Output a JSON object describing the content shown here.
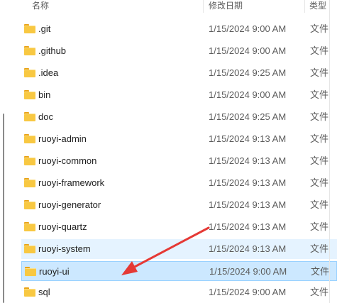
{
  "columns": {
    "name": "名称",
    "modified": "修改日期",
    "type": "类型"
  },
  "files": [
    {
      "name": ".git",
      "date": "1/15/2024 9:00 AM",
      "type": "文件",
      "icon": "folder-icon",
      "state": "normal"
    },
    {
      "name": ".github",
      "date": "1/15/2024 9:00 AM",
      "type": "文件",
      "icon": "folder-icon",
      "state": "normal"
    },
    {
      "name": ".idea",
      "date": "1/15/2024 9:25 AM",
      "type": "文件",
      "icon": "folder-icon",
      "state": "normal"
    },
    {
      "name": "bin",
      "date": "1/15/2024 9:00 AM",
      "type": "文件",
      "icon": "folder-icon",
      "state": "normal"
    },
    {
      "name": "doc",
      "date": "1/15/2024 9:25 AM",
      "type": "文件",
      "icon": "folder-icon",
      "state": "normal"
    },
    {
      "name": "ruoyi-admin",
      "date": "1/15/2024 9:13 AM",
      "type": "文件",
      "icon": "folder-icon",
      "state": "normal"
    },
    {
      "name": "ruoyi-common",
      "date": "1/15/2024 9:13 AM",
      "type": "文件",
      "icon": "folder-icon",
      "state": "normal"
    },
    {
      "name": "ruoyi-framework",
      "date": "1/15/2024 9:13 AM",
      "type": "文件",
      "icon": "folder-icon",
      "state": "normal"
    },
    {
      "name": "ruoyi-generator",
      "date": "1/15/2024 9:13 AM",
      "type": "文件",
      "icon": "folder-icon",
      "state": "normal"
    },
    {
      "name": "ruoyi-quartz",
      "date": "1/15/2024 9:13 AM",
      "type": "文件",
      "icon": "folder-icon",
      "state": "normal"
    },
    {
      "name": "ruoyi-system",
      "date": "1/15/2024 9:13 AM",
      "type": "文件",
      "icon": "folder-icon",
      "state": "hover"
    },
    {
      "name": "ruoyi-ui",
      "date": "1/15/2024 9:00 AM",
      "type": "文件",
      "icon": "folder-icon",
      "state": "selected"
    },
    {
      "name": "sql",
      "date": "1/15/2024 9:00 AM",
      "type": "文件",
      "icon": "folder-icon",
      "state": "normal"
    }
  ],
  "colors": {
    "folder": "#f8c842",
    "hover_row": "#e5f3ff",
    "selected_row": "#cce8ff",
    "annotation_arrow": "#e53935"
  }
}
